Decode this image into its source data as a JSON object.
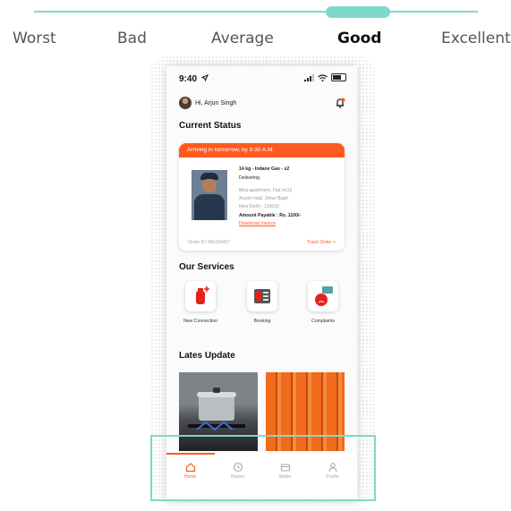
{
  "rating_scale": {
    "options": [
      "Worst",
      "Bad",
      "Average",
      "Good",
      "Excellent"
    ],
    "selected": "Good"
  },
  "statusbar": {
    "time": "9:40"
  },
  "header": {
    "greeting": "Hi, Arjun Singh"
  },
  "current_status": {
    "title": "Current Status",
    "banner": "Arriving in tomorrow, by 9:30 A.M.",
    "product": "14 kg - Indane Gas - x2",
    "state": "Delivering",
    "address_line1": "Mira apartment, Flat no12",
    "address_line2": "Aruoh road, Johar Bagh",
    "address_line3": "New Delhi - 110016",
    "amount": "Amount Payable : Rs. 1100/-",
    "invoice_link": "Download Invoice",
    "order_id": "Order ID #86334457",
    "track_link": "Track Order >"
  },
  "services": {
    "title": "Our Services",
    "items": [
      {
        "label": "New Connection",
        "icon": "gas-cylinder-plus-icon"
      },
      {
        "label": "Booking",
        "icon": "booking-icon"
      },
      {
        "label": "Complaints",
        "icon": "complaint-icon"
      }
    ]
  },
  "updates": {
    "title": "Lates Update"
  },
  "tabbar": {
    "active": "Home",
    "tabs": [
      "Home",
      "History",
      "Wallet",
      "Profile"
    ]
  },
  "colors": {
    "accent": "#ff5a1f",
    "scale": "#7ed9cc"
  }
}
